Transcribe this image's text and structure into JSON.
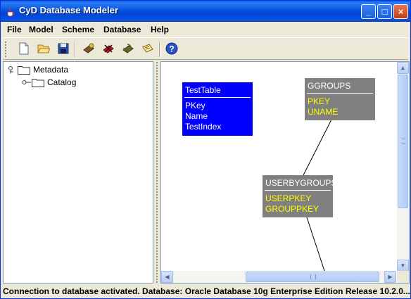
{
  "window": {
    "title": "CyD Database Modeler",
    "minimize_label": "_",
    "maximize_label": "□",
    "close_label": "×"
  },
  "menu": {
    "items": [
      "File",
      "Model",
      "Scheme",
      "Database",
      "Help"
    ]
  },
  "toolbar": {
    "buttons": [
      "new-document-icon",
      "open-folder-icon",
      "save-disk-icon",
      "connect-database-icon",
      "disconnect-database-icon",
      "refresh-database-icon",
      "edit-note-icon",
      "help-icon"
    ]
  },
  "tree": {
    "root": "Metadata",
    "child": "Catalog"
  },
  "diagram": {
    "tables": [
      {
        "name": "TestTable",
        "fields": [
          "PKey",
          "Name",
          "TestIndex"
        ],
        "bg": "#0000ff",
        "field_color": "#ffffff"
      },
      {
        "name": "GGROUPS",
        "fields": [
          "PKEY",
          "UNAME"
        ],
        "bg": "#808080",
        "field_color": "#ffff00"
      },
      {
        "name": "USERBYGROUPS",
        "fields": [
          "USERPKEY",
          "GROUPPKEY"
        ],
        "bg": "#808080",
        "field_color": "#ffff00"
      }
    ]
  },
  "status": {
    "text": "Connection to database activated. Database: Oracle Database 10g Enterprise Edition Release 10.2.0...."
  }
}
